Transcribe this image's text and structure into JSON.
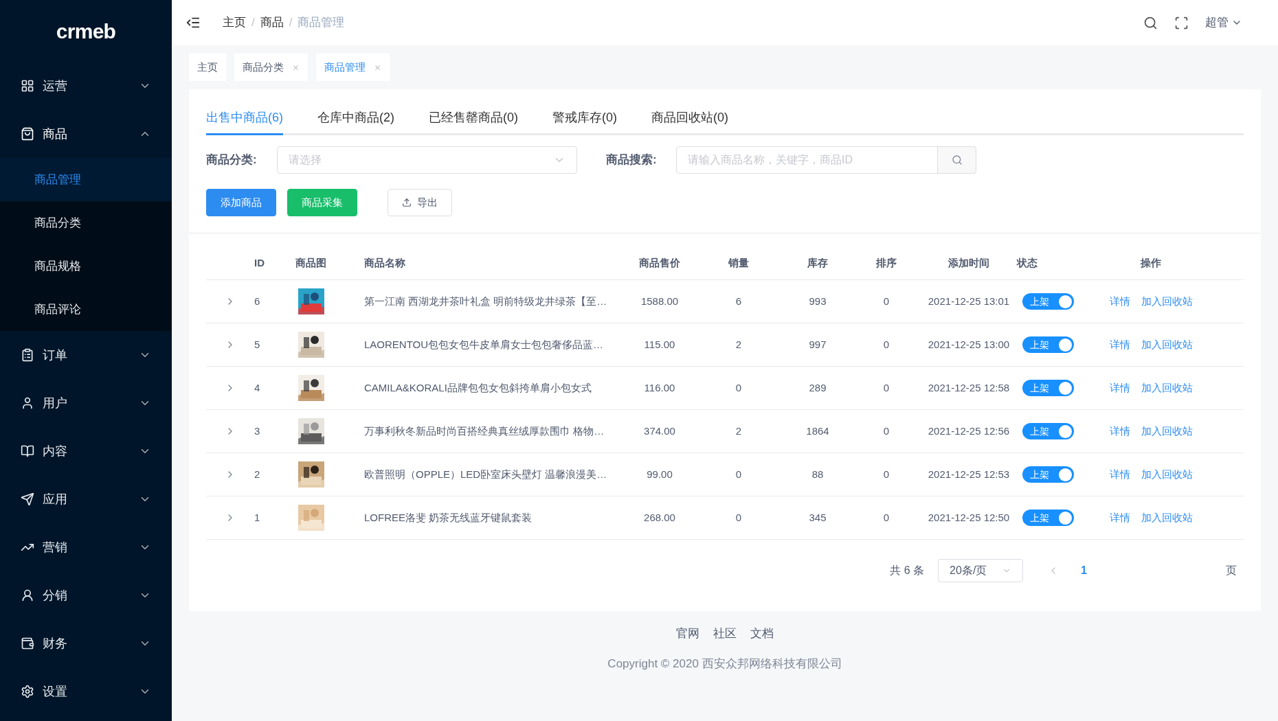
{
  "sidebar": {
    "logo": "crmeb",
    "items": [
      {
        "label": "运营",
        "expanded": false
      },
      {
        "label": "商品",
        "expanded": true,
        "children": [
          {
            "label": "商品管理",
            "selected": true
          },
          {
            "label": "商品分类",
            "selected": false
          },
          {
            "label": "商品规格",
            "selected": false
          },
          {
            "label": "商品评论",
            "selected": false
          }
        ]
      },
      {
        "label": "订单",
        "expanded": false
      },
      {
        "label": "用户",
        "expanded": false
      },
      {
        "label": "内容",
        "expanded": false
      },
      {
        "label": "应用",
        "expanded": false
      },
      {
        "label": "营销",
        "expanded": false
      },
      {
        "label": "分销",
        "expanded": false
      },
      {
        "label": "财务",
        "expanded": false
      },
      {
        "label": "设置",
        "expanded": false
      }
    ]
  },
  "header": {
    "separator": "/",
    "breadcrumbs": [
      {
        "label": "主页",
        "current": false
      },
      {
        "label": "商品",
        "current": false
      },
      {
        "label": "商品管理",
        "current": true
      }
    ],
    "user": "超管"
  },
  "page_tabs": [
    {
      "label": "主页",
      "selected": false,
      "closable": false
    },
    {
      "label": "商品分类",
      "selected": false,
      "closable": true
    },
    {
      "label": "商品管理",
      "selected": true,
      "closable": true
    }
  ],
  "product_tabs": [
    {
      "label": "出售中商品(6)",
      "selected": true
    },
    {
      "label": "仓库中商品(2)",
      "selected": false
    },
    {
      "label": "已经售罄商品(0)",
      "selected": false
    },
    {
      "label": "警戒库存(0)",
      "selected": false
    },
    {
      "label": "商品回收站(0)",
      "selected": false
    }
  ],
  "filters": {
    "category": {
      "label": "商品分类:",
      "placeholder": "请选择"
    },
    "search": {
      "label": "商品搜索:",
      "placeholder": "请输入商品名称，关键字，商品ID"
    }
  },
  "buttons": [
    {
      "label": "添加商品",
      "kind": "primary"
    },
    {
      "label": "商品采集",
      "kind": "success"
    },
    {
      "label": "导出",
      "kind": "export"
    }
  ],
  "table": {
    "columns": [
      "ID",
      "商品图",
      "商品名称",
      "商品售价",
      "销量",
      "库存",
      "排序",
      "添加时间",
      "状态",
      "操作"
    ],
    "rows": [
      {
        "id": "6",
        "name": "第一江南 西湖龙井茶叶礼盒 明前特级龙井绿茶【至…",
        "price": "1588.00",
        "sales": "6",
        "stock": "993",
        "sort": "0",
        "time": "2021-12-25 13:01",
        "status": {
          "label": "上架",
          "on": true
        },
        "actions": [
          "详情",
          "加入回收站"
        ]
      },
      {
        "id": "5",
        "name": "LAORENTOU包包女包牛皮单肩女士包包奢侈品蓝…",
        "price": "115.00",
        "sales": "2",
        "stock": "997",
        "sort": "0",
        "time": "2021-12-25 13:00",
        "status": {
          "label": "上架",
          "on": true
        },
        "actions": [
          "详情",
          "加入回收站"
        ]
      },
      {
        "id": "4",
        "name": "CAMILA&KORALI品牌包包女包斜挎单肩小包女式",
        "price": "116.00",
        "sales": "0",
        "stock": "289",
        "sort": "0",
        "time": "2021-12-25 12:58",
        "status": {
          "label": "上架",
          "on": true
        },
        "actions": [
          "详情",
          "加入回收站"
        ]
      },
      {
        "id": "3",
        "name": "万事利秋冬新品时尚百搭经典真丝绒厚款围巾 格物…",
        "price": "374.00",
        "sales": "2",
        "stock": "1864",
        "sort": "0",
        "time": "2021-12-25 12:56",
        "status": {
          "label": "上架",
          "on": true
        },
        "actions": [
          "详情",
          "加入回收站"
        ]
      },
      {
        "id": "2",
        "name": "欧普照明（OPPLE）LED卧室床头壁灯 温馨浪漫美…",
        "price": "99.00",
        "sales": "0",
        "stock": "88",
        "sort": "0",
        "time": "2021-12-25 12:53",
        "status": {
          "label": "上架",
          "on": true
        },
        "actions": [
          "详情",
          "加入回收站"
        ]
      },
      {
        "id": "1",
        "name": "LOFREE洛斐 奶茶无线蓝牙键鼠套装",
        "price": "268.00",
        "sales": "0",
        "stock": "345",
        "sort": "0",
        "time": "2021-12-25 12:50",
        "status": {
          "label": "上架",
          "on": true
        },
        "actions": [
          "详情",
          "加入回收站"
        ]
      }
    ]
  },
  "pagination": {
    "total": "共 6 条",
    "page_size": "20条/页",
    "pages": [
      {
        "label": "1",
        "selected": true
      }
    ],
    "tail": "页"
  },
  "footer": {
    "links": [
      "官网",
      "社区",
      "文档"
    ],
    "copyright": "Copyright © 2020 西安众邦网络科技有限公司"
  }
}
